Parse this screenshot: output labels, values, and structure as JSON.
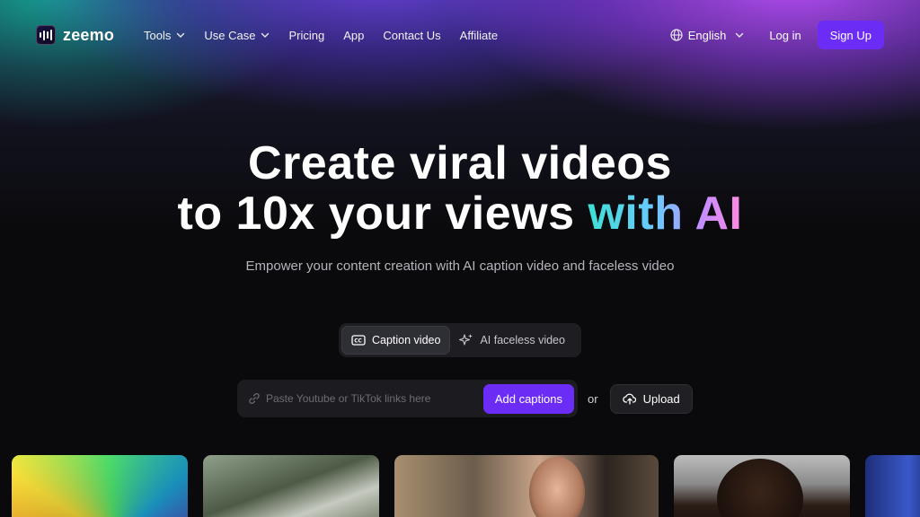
{
  "brand": {
    "name": "zeemo"
  },
  "nav": {
    "items": [
      {
        "label": "Tools",
        "has_dropdown": true
      },
      {
        "label": "Use Case",
        "has_dropdown": true
      },
      {
        "label": "Pricing",
        "has_dropdown": false
      },
      {
        "label": "App",
        "has_dropdown": false
      },
      {
        "label": "Contact Us",
        "has_dropdown": false
      },
      {
        "label": "Affiliate",
        "has_dropdown": false
      }
    ],
    "language": "English",
    "login_label": "Log in",
    "signup_label": "Sign Up"
  },
  "hero": {
    "title_line1": "Create viral videos",
    "title_line2_plain": "to 10x your views ",
    "title_line2_highlight": "with AI",
    "subtitle": "Empower your content creation with AI caption video and faceless video"
  },
  "modes": [
    {
      "label": "Caption video",
      "icon": "closed-caption-icon",
      "active": true
    },
    {
      "label": "AI faceless video",
      "icon": "sparkles-icon",
      "active": false
    }
  ],
  "link_input": {
    "placeholder": "Paste Youtube or TikTok links here",
    "value": ""
  },
  "actions": {
    "add_captions_label": "Add captions",
    "or_label": "or",
    "upload_label": "Upload"
  },
  "colors": {
    "accent": "#6b2cf5",
    "background": "#0a0a0c"
  }
}
